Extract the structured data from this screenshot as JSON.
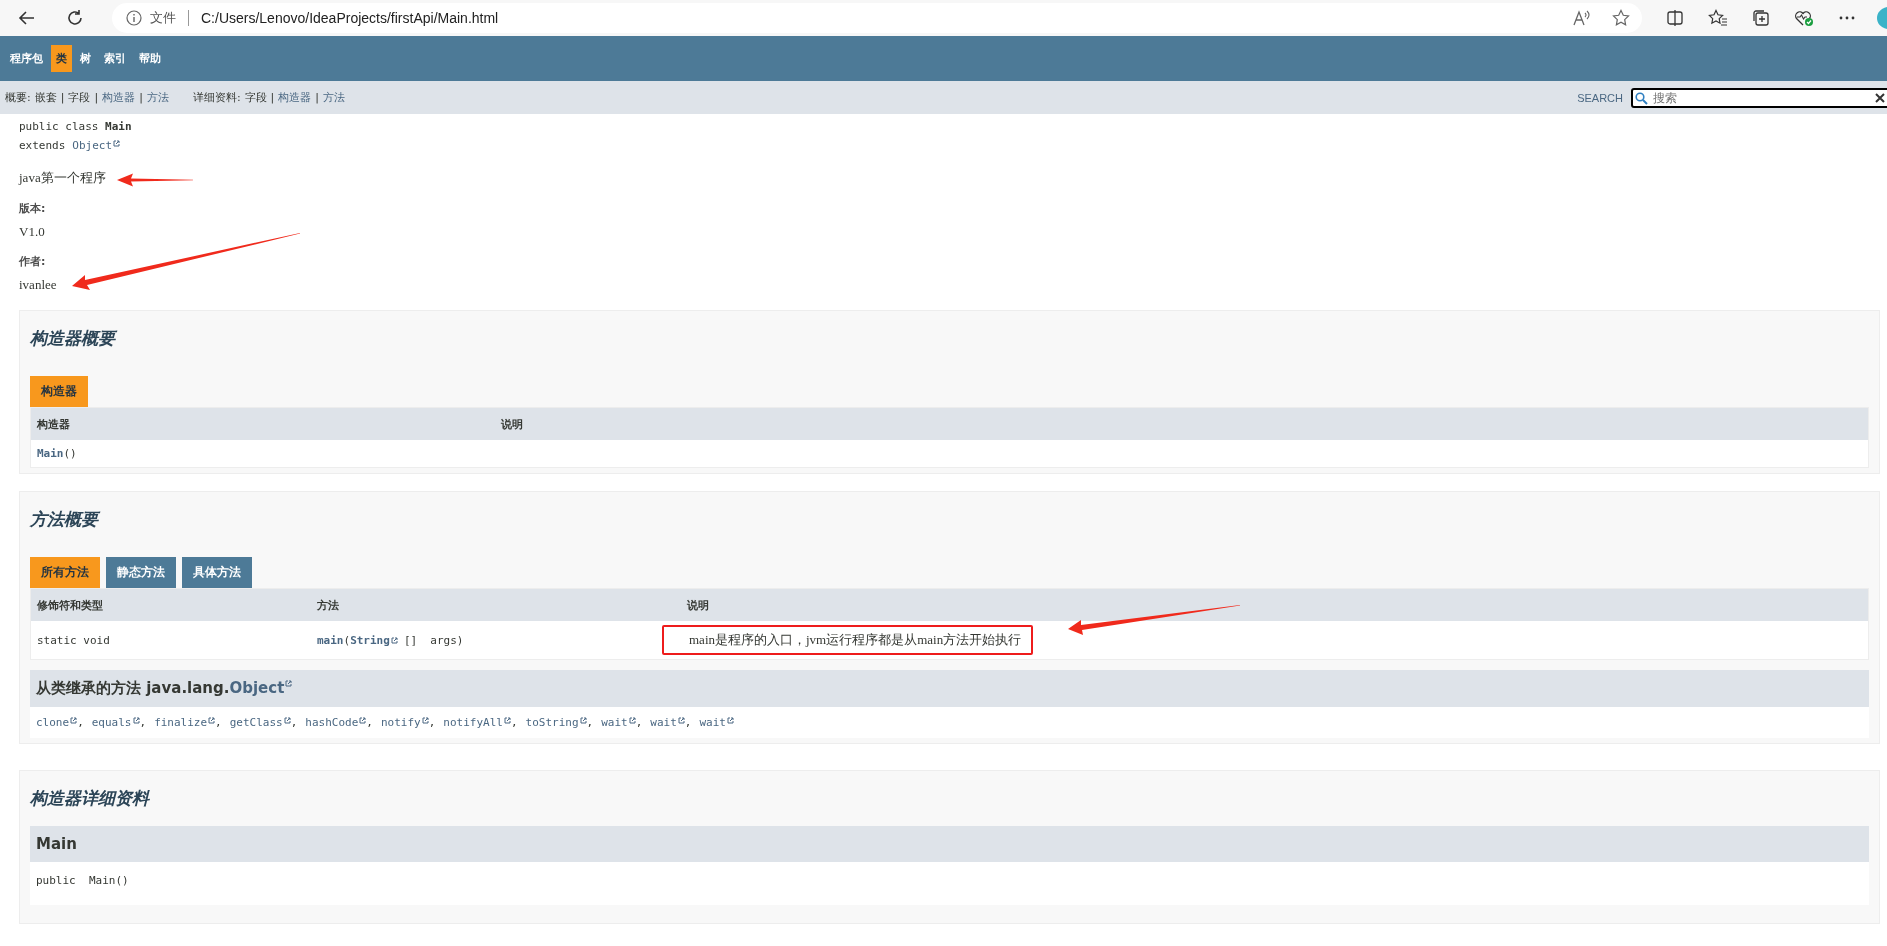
{
  "browser": {
    "url_label": "文件",
    "url": "C:/Users/Lenovo/IdeaProjects/firstApi/Main.html"
  },
  "nav": {
    "items": [
      {
        "label": "程序包",
        "selected": false
      },
      {
        "label": "类",
        "selected": true
      },
      {
        "label": "树",
        "selected": false
      },
      {
        "label": "索引",
        "selected": false
      },
      {
        "label": "帮助",
        "selected": false
      }
    ]
  },
  "subnav": {
    "summary_label": "概要:",
    "summary_items": [
      {
        "label": "嵌套",
        "link": false
      },
      {
        "label": "字段",
        "link": false
      },
      {
        "label": "构造器",
        "link": true
      },
      {
        "label": "方法",
        "link": true
      }
    ],
    "detail_label": "详细资料:",
    "detail_items": [
      {
        "label": "字段",
        "link": false
      },
      {
        "label": "构造器",
        "link": true
      },
      {
        "label": "方法",
        "link": true
      }
    ],
    "separator": "|",
    "search_label": "SEARCH",
    "search_placeholder": "搜索"
  },
  "class_header": {
    "signature": "public class **Main**",
    "extends": "extends",
    "superclass": "Object",
    "description": "java第一个程序",
    "tags": [
      {
        "label": "版本:",
        "value": "V1.0"
      },
      {
        "label": "作者:",
        "value": "ivanlee"
      }
    ]
  },
  "constructor_summary": {
    "title": "构造器概要",
    "tabs": [
      {
        "label": "构造器",
        "selected": true
      }
    ],
    "columns": [
      "构造器",
      "说明"
    ],
    "rows": [
      {
        "name": "Main",
        "params": "()"
      }
    ]
  },
  "method_summary": {
    "title": "方法概要",
    "tabs": [
      {
        "label": "所有方法",
        "selected": true
      },
      {
        "label": "静态方法",
        "selected": false
      },
      {
        "label": "具体方法",
        "selected": false
      }
    ],
    "columns": [
      "修饰符和类型",
      "方法",
      "说明"
    ],
    "rows": [
      {
        "modifier": "static void",
        "method_name": "main",
        "open_paren": "(",
        "param_type": "String",
        "param_rest": "[]  args)",
        "description": "main是程序的入口，jvm运行程序都是从main方法开始执行",
        "highlighted": true
      }
    ],
    "inherited": {
      "prefix": "从类继承的方法 java.lang.",
      "class_name": "Object",
      "separator": ",",
      "methods": [
        "clone",
        "equals",
        "finalize",
        "getClass",
        "hashCode",
        "notify",
        "notifyAll",
        "toString",
        "wait",
        "wait",
        "wait"
      ]
    }
  },
  "constructor_detail": {
    "title": "构造器详细资料",
    "member": "Main",
    "signature": "public  Main()"
  }
}
